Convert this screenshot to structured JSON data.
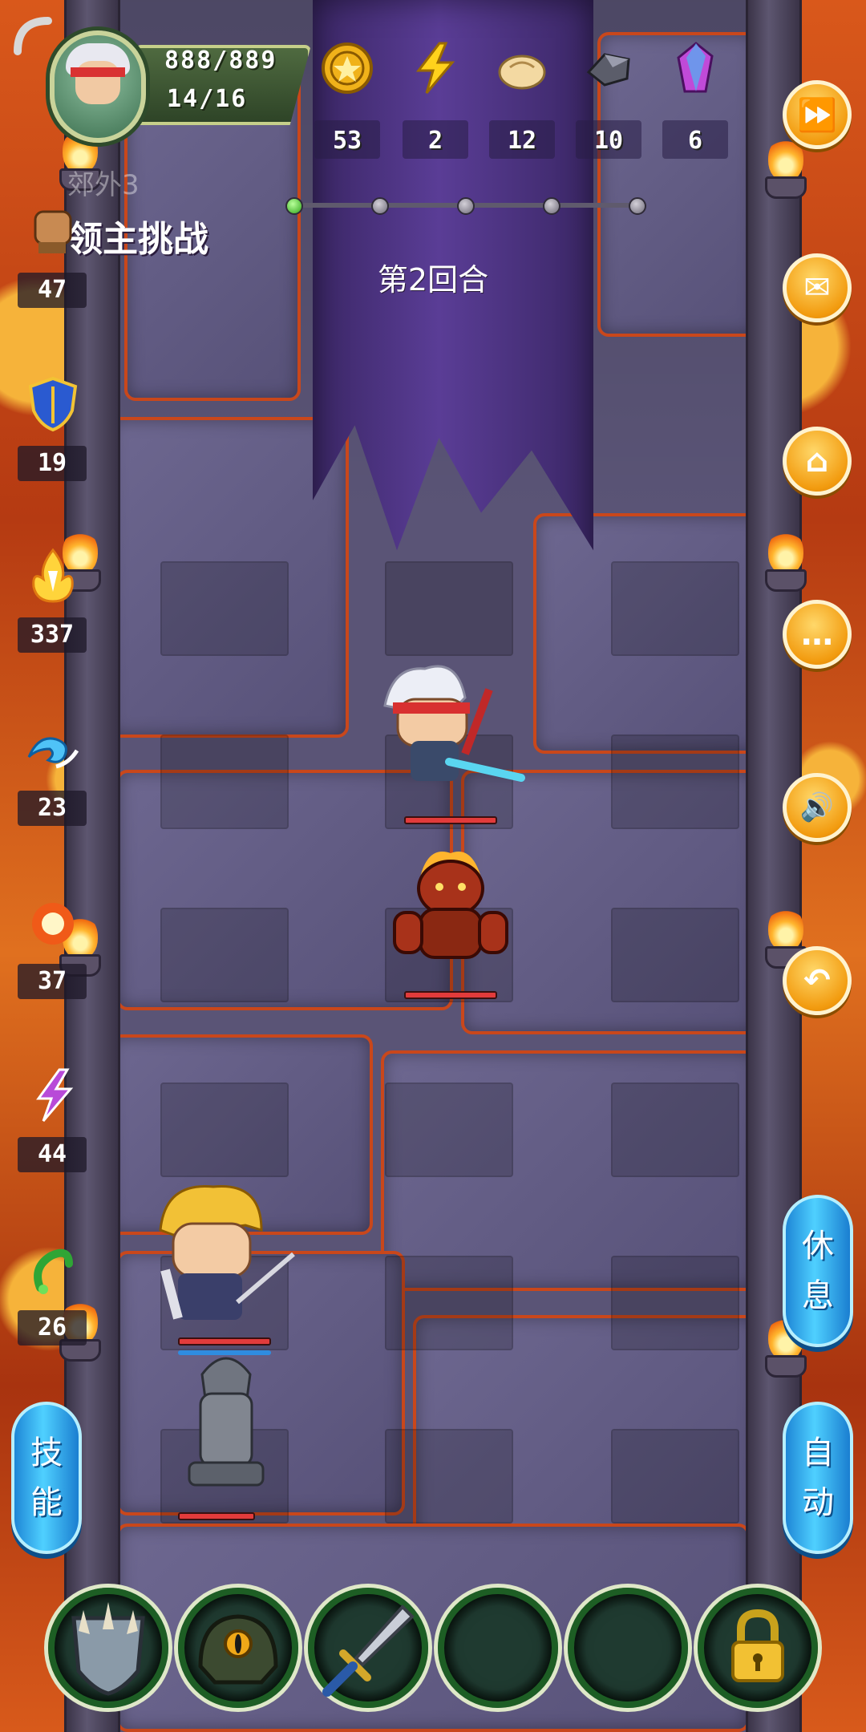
{
  "hud": {
    "hp": "888/889",
    "floor_progress": "14/16",
    "resources": [
      {
        "name": "gold-coin",
        "value": "53"
      },
      {
        "name": "lightning-energy",
        "value": "2"
      },
      {
        "name": "bun-food",
        "value": "12"
      },
      {
        "name": "iron-ore",
        "value": "10"
      },
      {
        "name": "crystal-gem",
        "value": "6"
      }
    ]
  },
  "stage": {
    "name": "郊外3",
    "challenge_label": "领主挑战",
    "round_label": "第2回合",
    "progress_nodes": 5,
    "progress_current": 1
  },
  "left_stats": [
    {
      "icon": "fist-attack-icon",
      "value": "47"
    },
    {
      "icon": "shield-defense-icon",
      "value": "19"
    },
    {
      "icon": "fire-aura-icon",
      "value": "337"
    },
    {
      "icon": "water-wave-icon",
      "value": "23"
    },
    {
      "icon": "fireball-icon",
      "value": "37"
    },
    {
      "icon": "lightning-bolt-icon",
      "value": "44"
    },
    {
      "icon": "poison-vine-icon",
      "value": "26"
    }
  ],
  "right_buttons": [
    {
      "icon": "fast-forward-icon",
      "glyph": "⏩"
    },
    {
      "icon": "mail-icon",
      "glyph": "✉"
    },
    {
      "icon": "home-icon",
      "glyph": "⌂"
    },
    {
      "icon": "chat-icon",
      "glyph": "…"
    },
    {
      "icon": "sound-icon",
      "glyph": "🔊"
    },
    {
      "icon": "undo-icon",
      "glyph": "↶"
    }
  ],
  "side_buttons": {
    "rest": [
      "休",
      "息"
    ],
    "auto": [
      "自",
      "动"
    ],
    "skill": [
      "技",
      "能"
    ]
  },
  "units": {
    "hero_hp": 1.0,
    "fire_golem_hp": 1.0,
    "blonde_swordsman_hp": 1.0,
    "stone_statue_hp": 1.0
  },
  "equipment_slots": [
    {
      "name": "spiked-shield-slot",
      "filled": true
    },
    {
      "name": "eye-helmet-slot",
      "filled": true
    },
    {
      "name": "sword-slot",
      "filled": true
    },
    {
      "name": "empty-slot-1",
      "filled": false
    },
    {
      "name": "empty-slot-2",
      "filled": false
    },
    {
      "name": "locked-slot",
      "filled": false
    }
  ],
  "colors": {
    "lava": "#d9581b",
    "floor": "#5a5476",
    "banner": "#4a3280",
    "orange_button": "#f29b0f",
    "blue_button": "#3bb6f0",
    "hp_red": "#e23b3b"
  }
}
